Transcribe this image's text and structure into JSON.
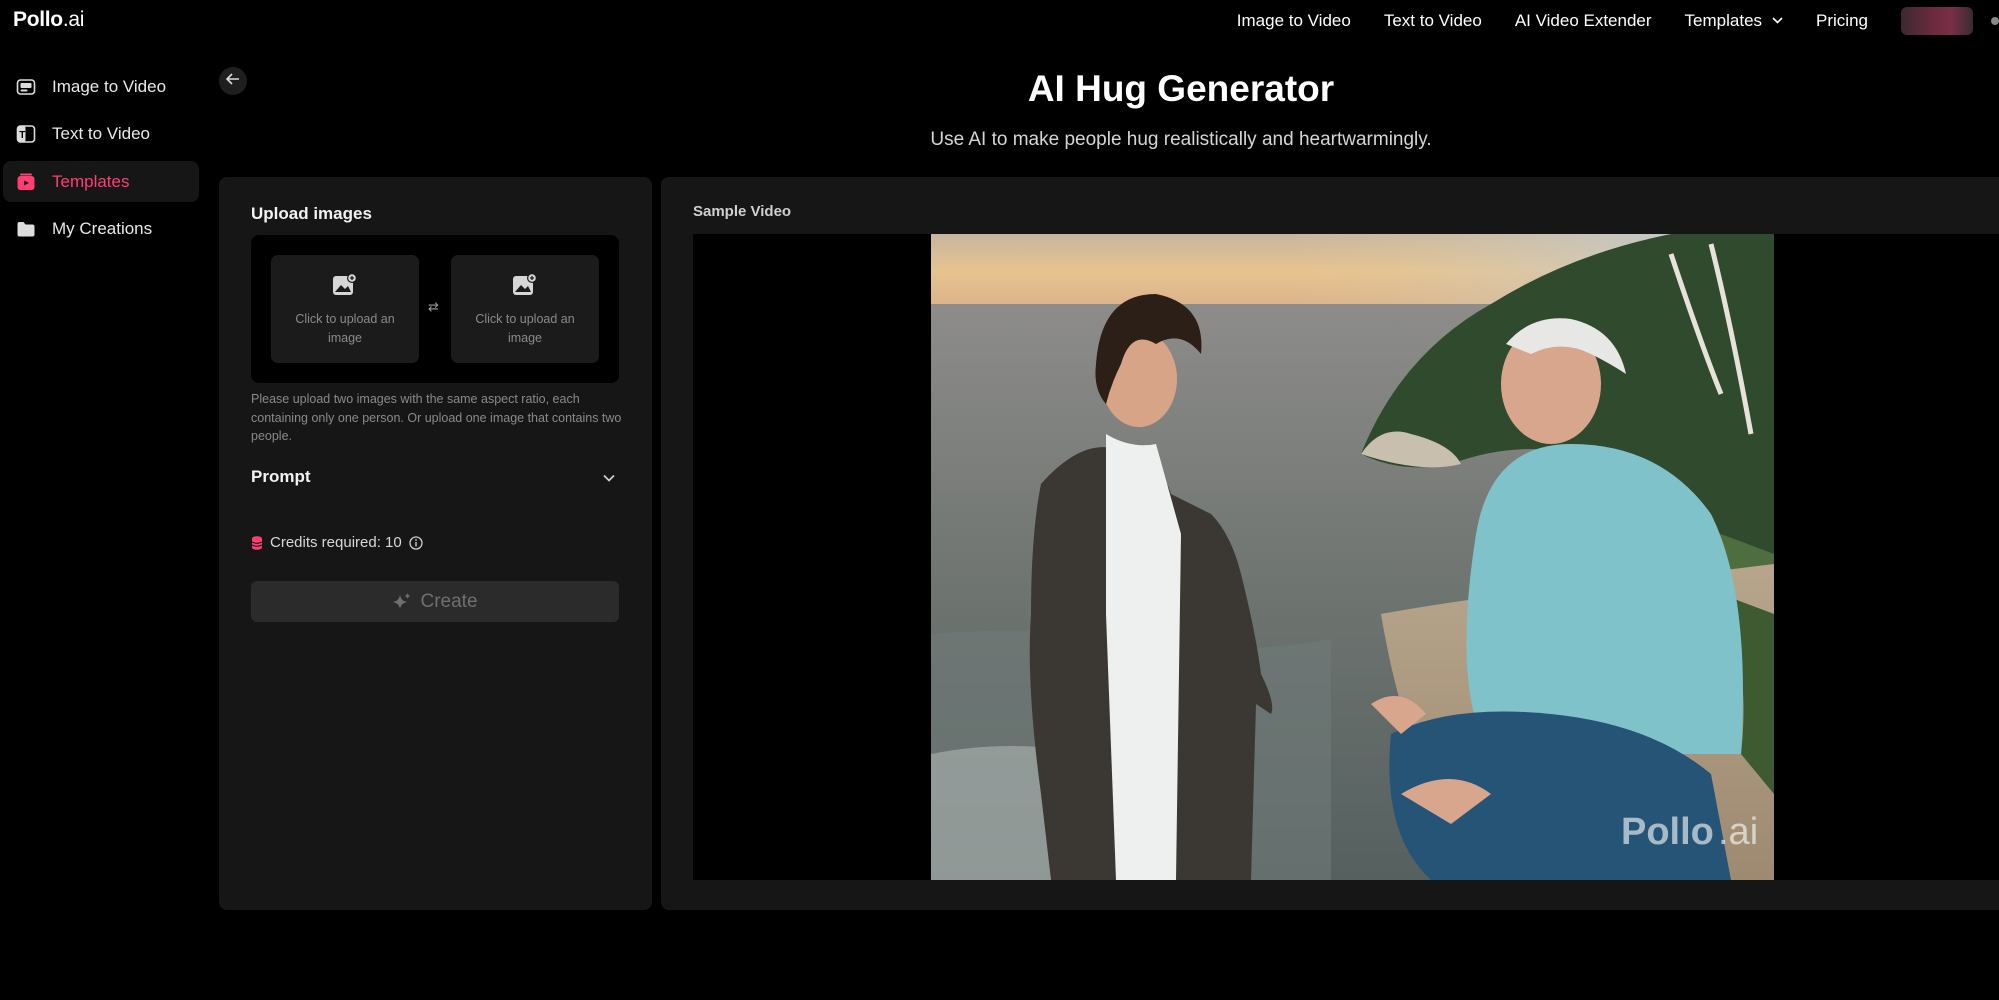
{
  "brand": {
    "logo_main": "Pollo",
    "logo_suffix": ".ai"
  },
  "topnav": {
    "items": [
      {
        "label": "Image to Video"
      },
      {
        "label": "Text to Video"
      },
      {
        "label": "AI Video Extender"
      },
      {
        "label": "Templates",
        "has_dropdown": true
      },
      {
        "label": "Pricing"
      }
    ]
  },
  "sidebar": {
    "items": [
      {
        "label": "Image to Video",
        "icon": "image-to-video-icon"
      },
      {
        "label": "Text to Video",
        "icon": "text-to-video-icon"
      },
      {
        "label": "Templates",
        "icon": "templates-icon",
        "active": true
      },
      {
        "label": "My Creations",
        "icon": "folder-icon"
      }
    ]
  },
  "header": {
    "title": "AI Hug Generator",
    "subtitle": "Use AI to make people hug realistically and heartwarmingly."
  },
  "form": {
    "upload_heading": "Upload images",
    "upload_slots": [
      {
        "text": "Click to upload an image"
      },
      {
        "text": "Click to upload an image"
      }
    ],
    "swap_symbol": "⇄",
    "hint": "Please upload two images with the same aspect ratio, each containing only one person. Or upload one image that contains two people.",
    "prompt_label": "Prompt",
    "credits_text": "Credits required: 10",
    "create_label": "Create"
  },
  "sample": {
    "label": "Sample Video",
    "watermark_main": "Pollo",
    "watermark_suffix": ".ai"
  },
  "colors": {
    "accent": "#ff3e74",
    "background": "#000000",
    "panel": "#161616",
    "button_disabled": "#2b2b2b"
  }
}
